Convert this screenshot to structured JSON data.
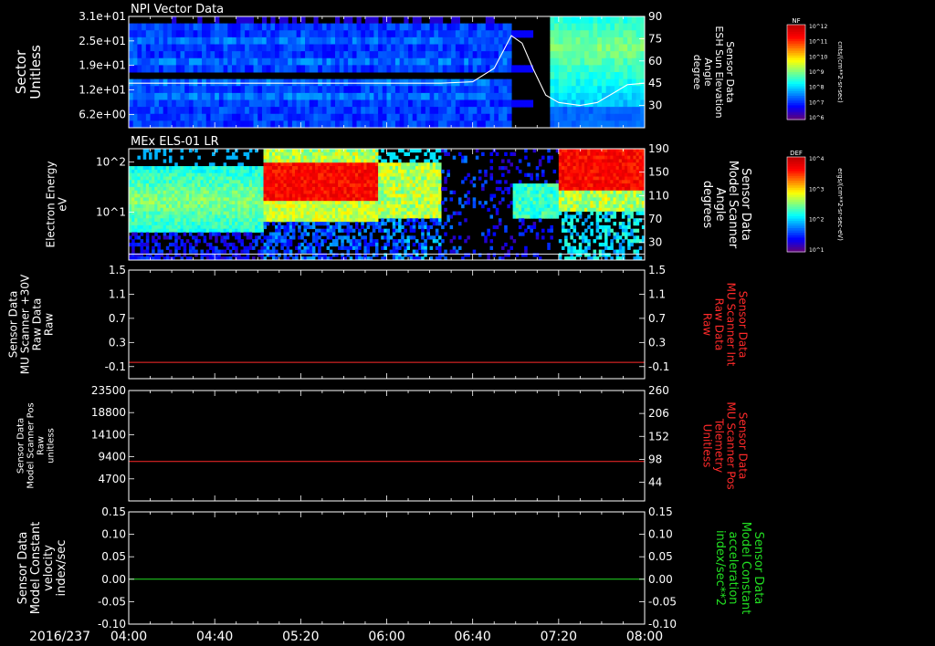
{
  "date_label": "2016/237",
  "colors": {
    "red": "#ff2a2a",
    "green": "#22dd22",
    "white": "#ffffff"
  },
  "time_axis": {
    "start": "04:00",
    "end": "08:00",
    "ticks": [
      "04:00",
      "04:40",
      "05:20",
      "06:00",
      "06:40",
      "07:20",
      "08:00"
    ]
  },
  "colorbars": [
    {
      "label": "NF",
      "unit": "cnts/(cm**2-sr-sec)",
      "ticks": [
        "10^12",
        "10^11",
        "10^10",
        "10^9",
        "10^8",
        "10^7",
        "10^6"
      ]
    },
    {
      "label": "DEF",
      "unit": "ergs/(cm**2-sr-sec-eV)",
      "ticks": [
        "10^4",
        "10^3",
        "10^2",
        "10^1"
      ]
    }
  ],
  "chart_data": [
    {
      "type": "heatmap",
      "title": "NPI Vector Data",
      "ylabel": [
        "Sector",
        "Unitless"
      ],
      "yticks": [
        "3.1e+01",
        "2.5e+01",
        "1.9e+01",
        "1.2e+01",
        "6.2e+00"
      ],
      "y2label": [
        "Sensor Data",
        "ESH Sun Elevation",
        "Angle",
        "degree"
      ],
      "y2ticks": [
        "90",
        "75",
        "60",
        "45",
        "30"
      ],
      "y2lim": [
        15,
        90
      ],
      "overlay": {
        "name": "ESH Sun Elevation",
        "x": [
          "04:00",
          "06:25",
          "06:40",
          "06:50",
          "06:58",
          "07:03",
          "07:08",
          "07:14",
          "07:20",
          "07:30",
          "07:38",
          "07:45",
          "07:52",
          "08:00"
        ],
        "y": [
          45,
          45,
          46,
          55,
          77,
          72,
          55,
          37,
          32,
          30,
          32,
          38,
          44,
          45
        ]
      }
    },
    {
      "type": "heatmap",
      "title": "MEx ELS-01 LR",
      "ylabel": [
        "Electron Energy",
        "eV"
      ],
      "yticks": [
        "10^2",
        "10^1"
      ],
      "y2label": [
        "Sensor Data",
        "Model Scanner",
        "Angle",
        "degrees"
      ],
      "y2ticks": [
        "190",
        "150",
        "110",
        "70",
        "30"
      ],
      "y2lim": [
        0,
        190
      ],
      "overlay": {
        "name": "Model Scanner Angle",
        "x": [
          "04:00",
          "08:00"
        ],
        "y": [
          10,
          10
        ]
      }
    },
    {
      "type": "line",
      "ylabel": [
        "Sensor Data",
        "MU Scanner +30V",
        "Raw Data",
        "Raw"
      ],
      "yticks": [
        "1.5",
        "1.1",
        "0.7",
        "0.3",
        "-0.1"
      ],
      "ylim": [
        -0.3,
        1.5
      ],
      "y2label": [
        "Sensor Data",
        "MU Scanner Int",
        "Raw Data",
        "Raw"
      ],
      "y2ticks": [
        "1.5",
        "1.1",
        "0.7",
        "0.3",
        "-0.1"
      ],
      "series": [
        {
          "name": "MU Scanner Int",
          "color": "#ff2a2a",
          "x": [
            "04:00",
            "08:00"
          ],
          "y": [
            -0.03,
            -0.03
          ]
        }
      ]
    },
    {
      "type": "line",
      "ylabel": [
        "Sensor Data",
        "Model Scanner Pos",
        "Raw",
        "unitless"
      ],
      "yticks": [
        "23500",
        "18800",
        "14100",
        "9400",
        "4700"
      ],
      "ylim": [
        0,
        23500
      ],
      "y2label": [
        "Sensor Data",
        "MU Scanner Pos",
        "Telemetry",
        "Unitless"
      ],
      "y2ticks": [
        "260",
        "206",
        "152",
        "98",
        "44"
      ],
      "y2lim": [
        0,
        260
      ],
      "series": [
        {
          "name": "MU Scanner Pos",
          "color": "#ff2a2a",
          "x": [
            "04:00",
            "08:00"
          ],
          "y": [
            8400,
            8400
          ]
        }
      ]
    },
    {
      "type": "line",
      "ylabel": [
        "Sensor Data",
        "Model Constant",
        "velocity",
        "index/sec"
      ],
      "yticks": [
        "0.15",
        "0.10",
        "0.05",
        "0.00",
        "-0.05",
        "-0.10"
      ],
      "ylim": [
        -0.1,
        0.15
      ],
      "y2label": [
        "Sensor Data",
        "Model Constant",
        "acceleration",
        "index/sec**2"
      ],
      "y2ticks": [
        "0.15",
        "0.10",
        "0.05",
        "0.00",
        "-0.05",
        "-0.10"
      ],
      "series": [
        {
          "name": "Model Constant acceleration",
          "color": "#22dd22",
          "x": [
            "04:00",
            "08:00"
          ],
          "y": [
            0,
            0
          ]
        }
      ]
    }
  ]
}
